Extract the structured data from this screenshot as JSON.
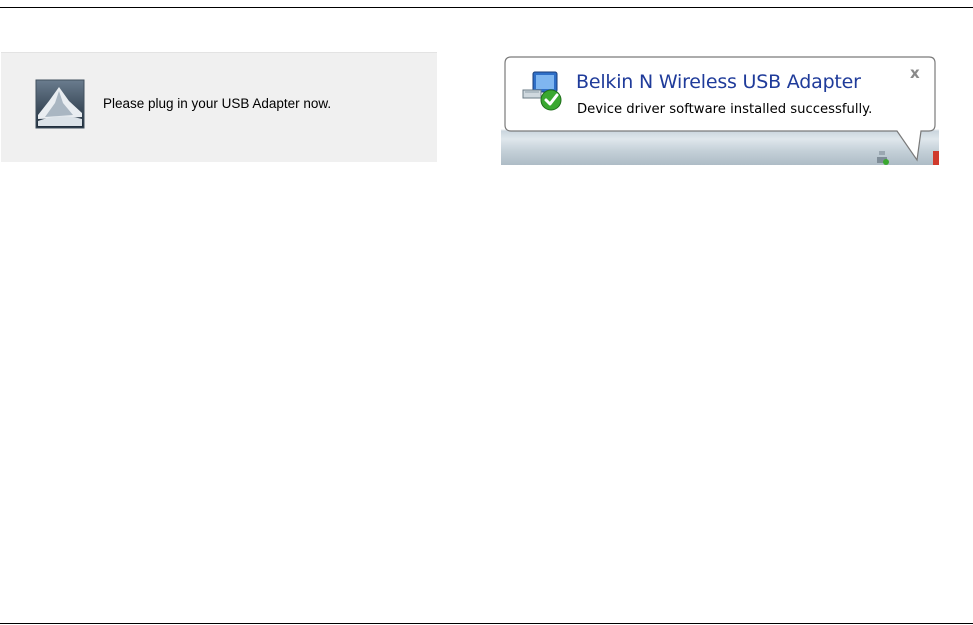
{
  "prompt": {
    "message": "Please plug in your USB Adapter now.",
    "icon": "installer-tent-icon"
  },
  "notification": {
    "title": "Belkin N Wireless USB Adapter",
    "message": "Device driver software installed successfully.",
    "close_label": "x",
    "icon": "network-adapter-check-icon"
  },
  "colors": {
    "title_blue": "#1f3b9a",
    "panel_gray": "#f0f0f0",
    "check_green": "#3aa830"
  }
}
